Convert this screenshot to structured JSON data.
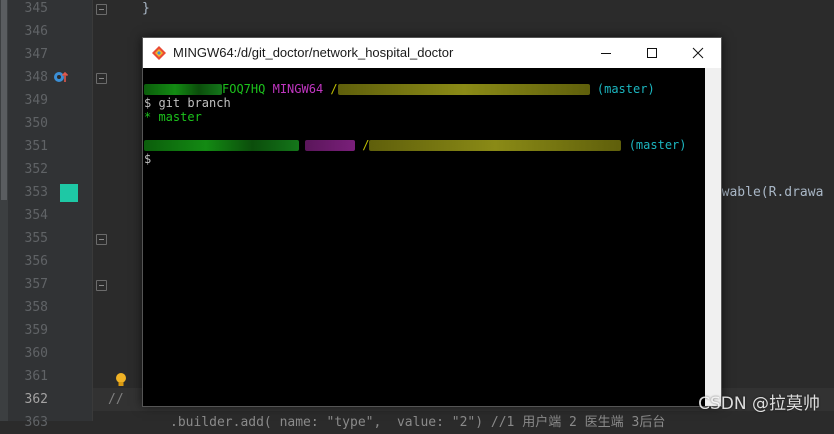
{
  "editor": {
    "line_numbers": [
      "345",
      "346",
      "347",
      "348",
      "349",
      "350",
      "351",
      "352",
      "353",
      "354",
      "355",
      "356",
      "357",
      "358",
      "359",
      "360",
      "361",
      "362",
      "363"
    ],
    "current_line": "362",
    "code_top": "}",
    "code_right": "rawable(R.drawa",
    "comment_line": "//",
    "code_bottom": ".builder.add( name: \"type\",  value: \"2\") //1 用户端 2 医生端 3后台"
  },
  "terminal": {
    "title": "MINGW64:/d/git_doctor/network_hospital_doctor",
    "prompt1": {
      "host_tail": "FOQ7HQ",
      "shell": "MINGW64",
      "path_lead": "/",
      "branch": "(master)"
    },
    "command": "$ git branch",
    "output": "* master",
    "prompt2": {
      "path_lead": "/",
      "branch": "(master)"
    },
    "cursor_line": "$"
  },
  "watermark": "CSDN @拉莫帅"
}
